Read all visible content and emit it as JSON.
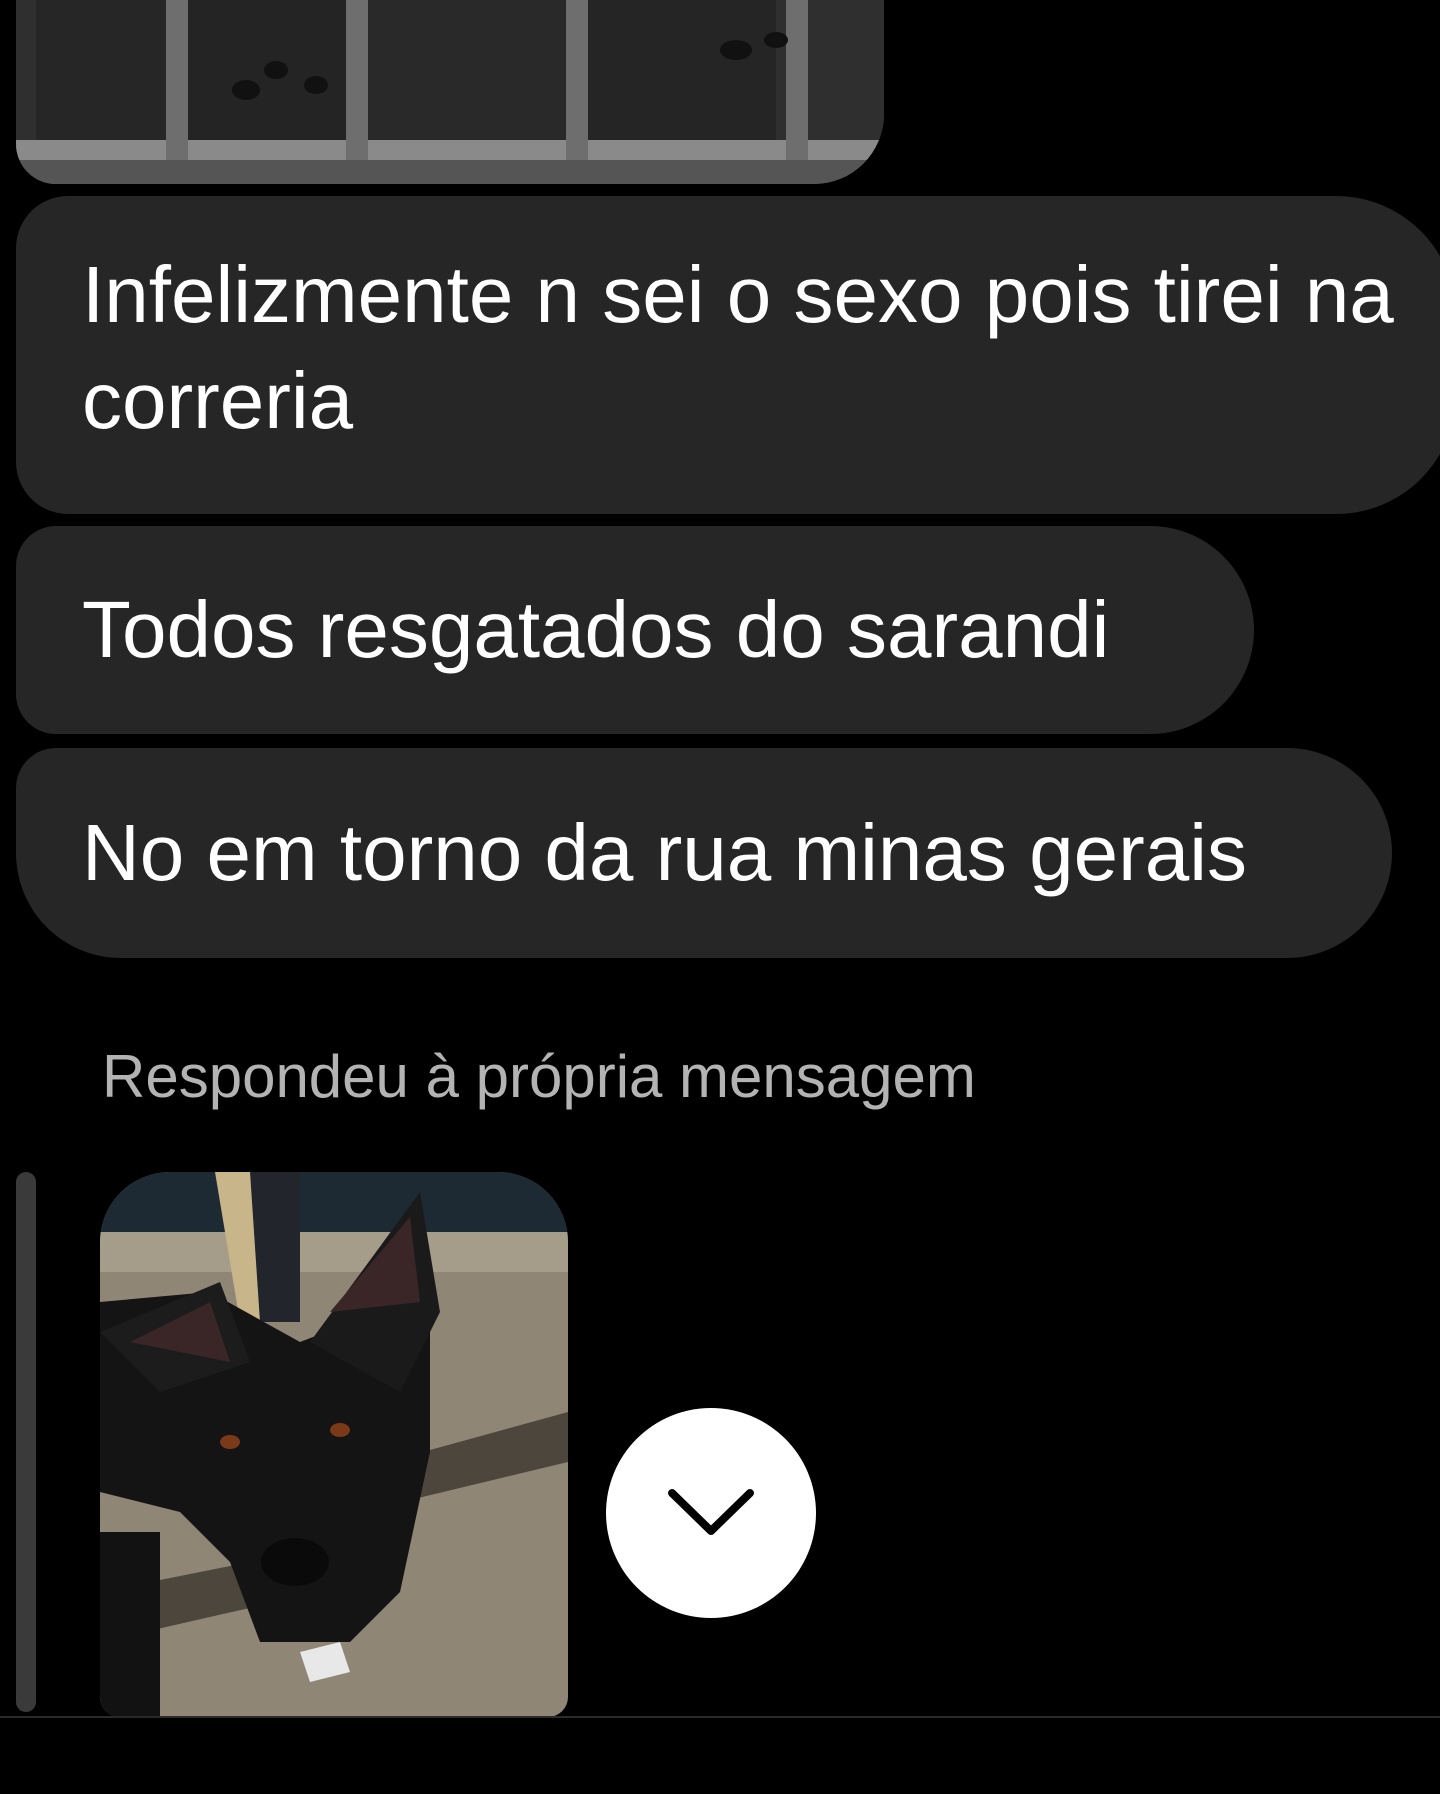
{
  "messages": [
    {
      "text": "Infelizmente n sei o sexo pois tirei na correria"
    },
    {
      "text": "Todos resgatados do sarandi"
    },
    {
      "text": "No em torno da rua minas gerais"
    }
  ],
  "reply": {
    "label": "Respondeu à própria mensagem"
  },
  "scroll_button": {
    "icon": "chevron-down-icon"
  },
  "bottom_preview": {
    "text": ""
  },
  "colors": {
    "background": "#000000",
    "bubble": "#262626",
    "text": "#ffffff",
    "secondary_text": "#b3b3b3"
  }
}
